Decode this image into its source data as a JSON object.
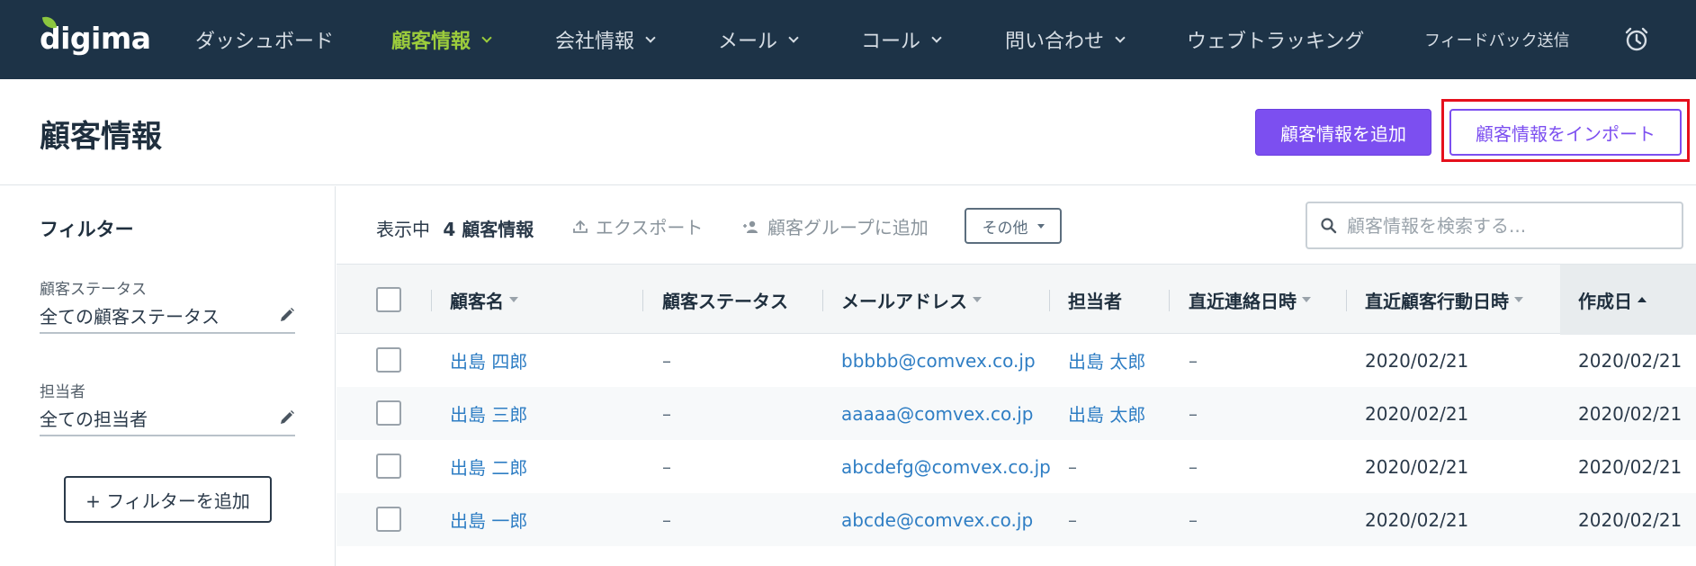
{
  "app": {
    "logo": "digima",
    "colors": {
      "nav_bg": "#1d3347",
      "accent": "#7c4ff0",
      "active_nav": "#9ccc3c",
      "link": "#2f7ec4",
      "highlight": "#e5101c"
    }
  },
  "nav": {
    "dashboard": "ダッシュボード",
    "customers": "顧客情報",
    "companies": "会社情報",
    "mail": "メール",
    "call": "コール",
    "inquiry": "問い合わせ",
    "webtracking": "ウェブトラッキング",
    "feedback": "フィードバック送信",
    "alarm_icon": "alarm-clock-icon"
  },
  "header": {
    "title": "顧客情報",
    "add_button": "顧客情報を追加",
    "import_button": "顧客情報をインポート"
  },
  "sidebar": {
    "title": "フィルター",
    "filters": [
      {
        "label": "顧客ステータス",
        "value": "全ての顧客ステータス"
      },
      {
        "label": "担当者",
        "value": "全ての担当者"
      }
    ],
    "add_filter_button": "+ フィルターを追加"
  },
  "toolbar": {
    "count_prefix": "表示中",
    "count_value": "4 顧客情報",
    "export": "エクスポート",
    "add_to_group": "顧客グループに追加",
    "more": "その他",
    "search_placeholder": "顧客情報を検索する..."
  },
  "table": {
    "columns": [
      "顧客名",
      "顧客ステータス",
      "メールアドレス",
      "担当者",
      "直近連絡日時",
      "直近顧客行動日時",
      "作成日"
    ],
    "rows": [
      {
        "name": "出島 四郎",
        "status": "–",
        "email": "bbbbb@comvex.co.jp",
        "owner": "出島 太郎",
        "last_contact": "–",
        "last_action": "2020/02/21",
        "created": "2020/02/21"
      },
      {
        "name": "出島 三郎",
        "status": "–",
        "email": "aaaaa@comvex.co.jp",
        "owner": "出島 太郎",
        "last_contact": "–",
        "last_action": "2020/02/21",
        "created": "2020/02/21"
      },
      {
        "name": "出島 二郎",
        "status": "–",
        "email": "abcdefg@comvex.co.jp",
        "owner": "–",
        "last_contact": "–",
        "last_action": "2020/02/21",
        "created": "2020/02/21"
      },
      {
        "name": "出島 一郎",
        "status": "–",
        "email": "abcde@comvex.co.jp",
        "owner": "–",
        "last_contact": "–",
        "last_action": "2020/02/21",
        "created": "2020/02/21"
      }
    ]
  }
}
